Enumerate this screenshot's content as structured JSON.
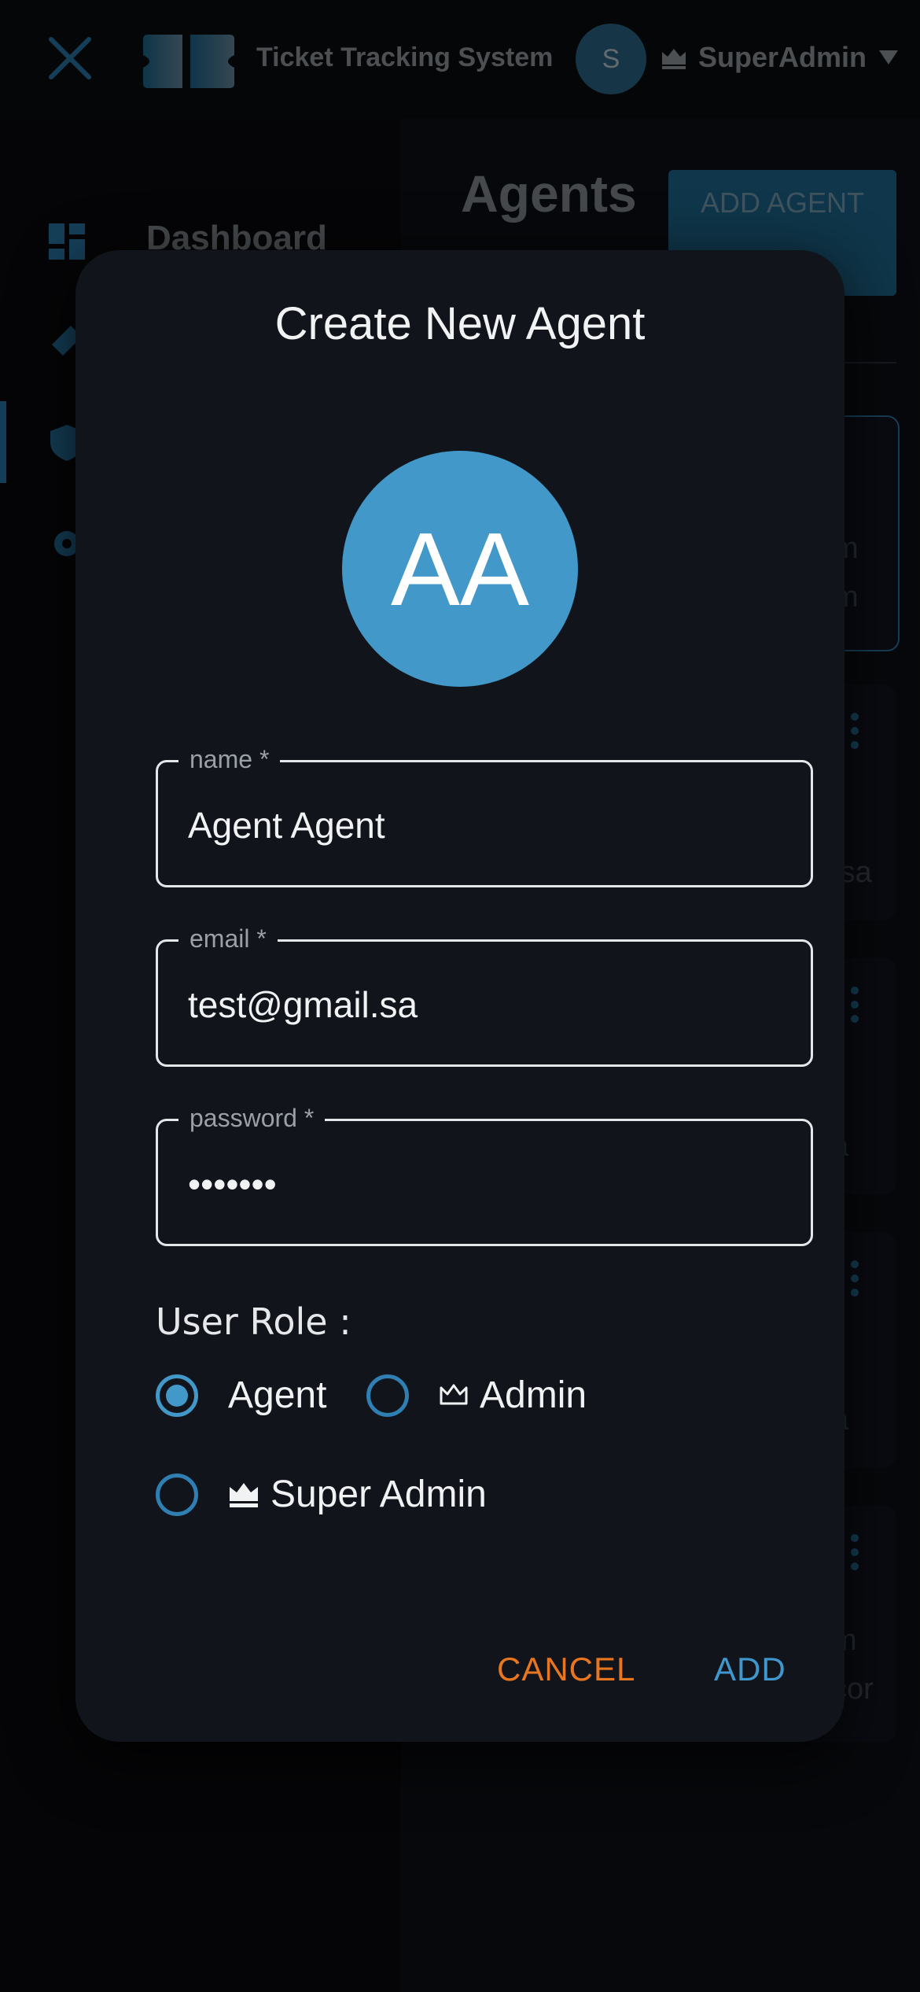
{
  "header": {
    "app_title": "Ticket Tracking System",
    "user_initial": "S",
    "user_name": "SuperAdmin"
  },
  "sidebar": {
    "items": [
      {
        "icon": "dashboard-icon",
        "label": "Dashboard"
      },
      {
        "icon": "ticket-icon",
        "label": ""
      },
      {
        "icon": "shield-user-icon",
        "label": ""
      },
      {
        "icon": "gear-icon",
        "label": ""
      }
    ]
  },
  "main": {
    "title": "Agents",
    "add_button": "ADD AGENT",
    "card_peeks": [
      "m",
      "m",
      ".sa",
      "a",
      "a",
      "m",
      "cor"
    ]
  },
  "dialog": {
    "title": "Create New Agent",
    "avatar_initials": "AA",
    "fields": {
      "name": {
        "label": "name *",
        "value": "Agent Agent"
      },
      "email": {
        "label": "email *",
        "value": "test@gmail.sa"
      },
      "password": {
        "label": "password *",
        "value": "•••••••"
      }
    },
    "role_label": "User Role :",
    "roles": [
      {
        "label": "Agent",
        "icon": "",
        "checked": true
      },
      {
        "label": "Admin",
        "icon": "crown-outline-icon",
        "checked": false
      },
      {
        "label": "Super Admin",
        "icon": "crown-icon",
        "checked": false
      }
    ],
    "cancel_label": "CANCEL",
    "add_label": "ADD"
  },
  "colors": {
    "accent": "#4298c8",
    "cancel": "#e8761f",
    "dialog_bg": "#12141b"
  }
}
